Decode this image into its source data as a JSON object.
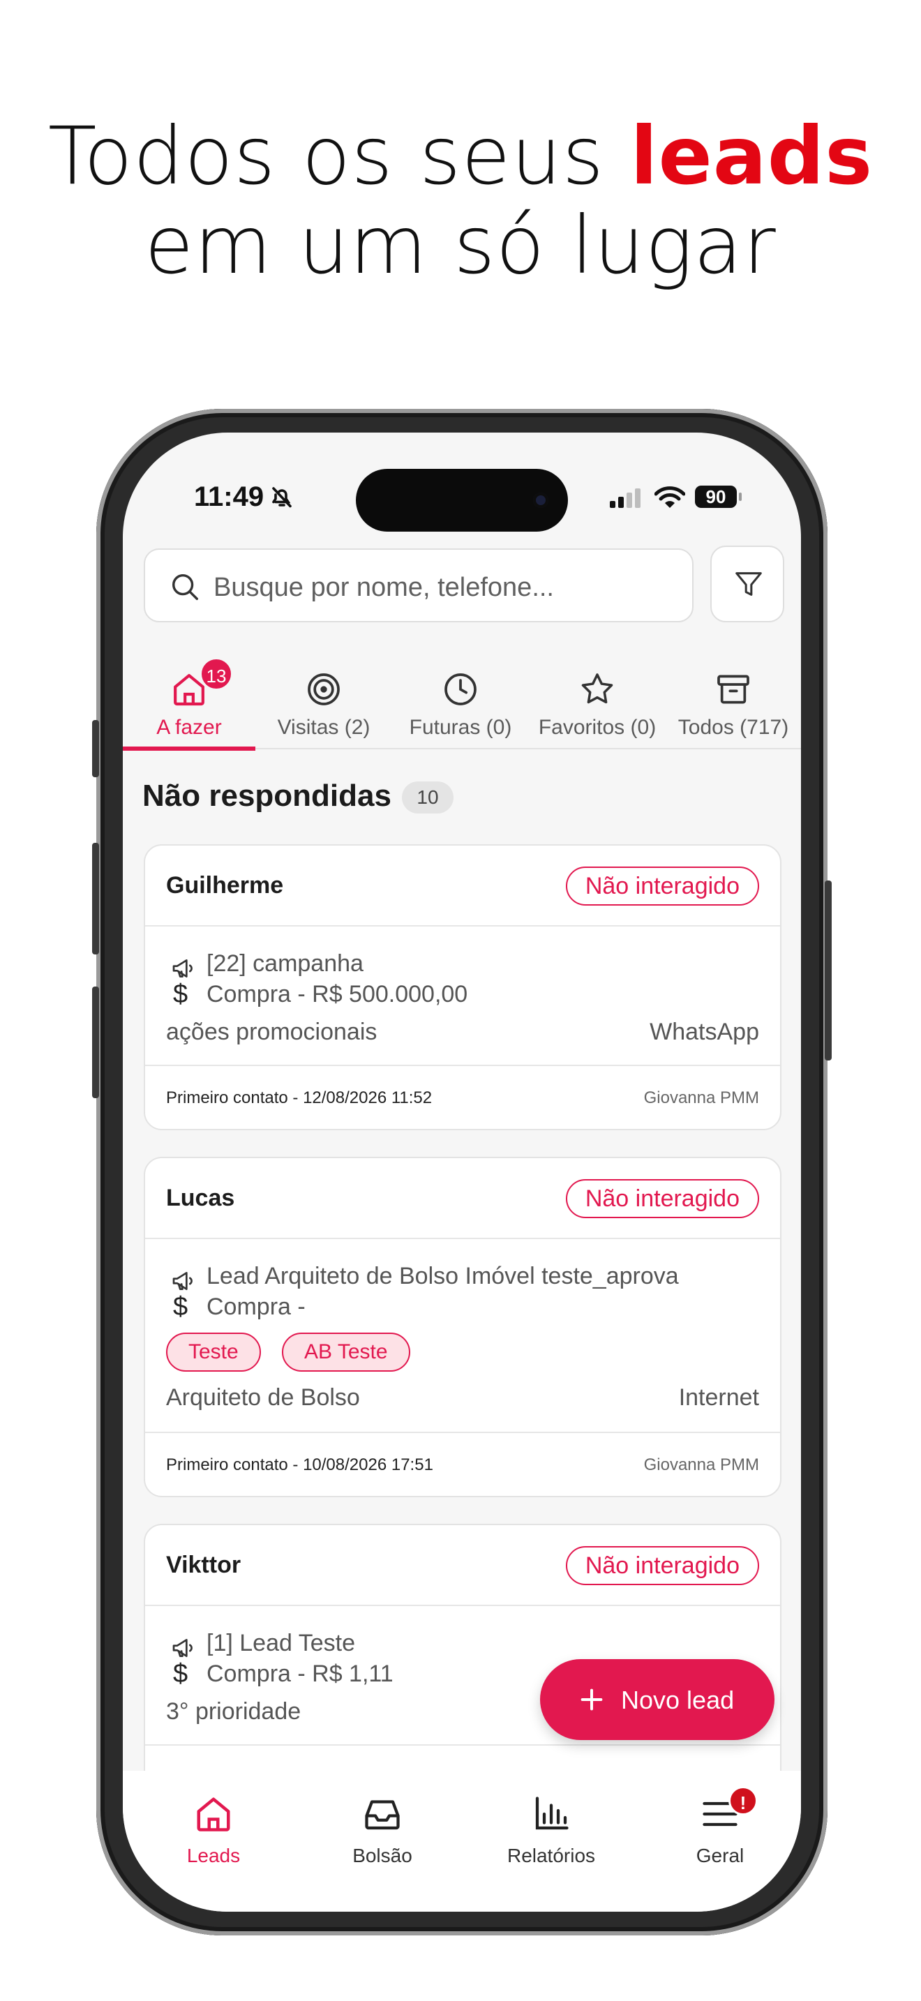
{
  "headline": {
    "line1_prefix": "Todos os seus ",
    "line1_accent": "leads",
    "line2": "em um só lugar"
  },
  "status_bar": {
    "time": "11:49",
    "battery": "90"
  },
  "search": {
    "placeholder": "Busque por nome, telefone..."
  },
  "tabs": [
    {
      "label": "A fazer",
      "badge": "13",
      "icon": "home-icon",
      "active": true
    },
    {
      "label": "Visitas (2)",
      "icon": "target-icon"
    },
    {
      "label": "Futuras (0)",
      "icon": "clock-icon"
    },
    {
      "label": "Favoritos (0)",
      "icon": "star-icon"
    },
    {
      "label": "Todos (717)",
      "icon": "archive-icon"
    }
  ],
  "section": {
    "title": "Não respondidas",
    "count": "10"
  },
  "leads": [
    {
      "name": "Guilherme",
      "status": "Não interagido",
      "campaign": "[22] campanha",
      "deal": "Compra - R$ 500.000,00",
      "origin": "ações promocionais",
      "channel": "WhatsApp",
      "first_contact": "Primeiro contato - 12/08/2026 11:52",
      "agent": "Giovanna PMM"
    },
    {
      "name": "Lucas",
      "status": "Não interagido",
      "campaign": "Lead Arquiteto de Bolso Imóvel teste_aprova",
      "deal": "Compra -",
      "tags": [
        "Teste",
        "AB Teste"
      ],
      "origin": "Arquiteto de Bolso",
      "channel": "Internet",
      "first_contact": "Primeiro contato - 10/08/2026 17:51",
      "agent": "Giovanna PMM"
    },
    {
      "name": "Vikttor",
      "status": "Não interagido",
      "campaign": "[1] Lead Teste",
      "deal": "Compra - R$ 1,11",
      "origin": "3° prioridade"
    }
  ],
  "fab": {
    "label": "Novo lead",
    "icon": "plus-icon"
  },
  "bottom_nav": [
    {
      "label": "Leads",
      "icon": "home-icon",
      "active": true
    },
    {
      "label": "Bolsão",
      "icon": "inbox-icon"
    },
    {
      "label": "Relatórios",
      "icon": "bar-chart-icon"
    },
    {
      "label": "Geral",
      "icon": "menu-icon",
      "badge": "!"
    }
  ],
  "colors": {
    "accent": "#e2184f",
    "headline_accent": "#e30613",
    "badge_alert": "#d0101c"
  }
}
